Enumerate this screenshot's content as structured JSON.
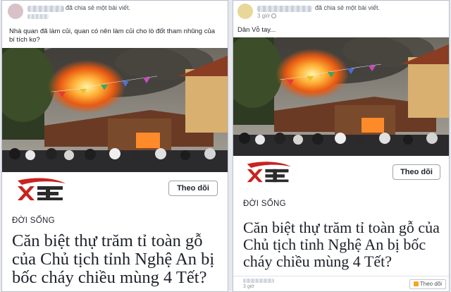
{
  "posts": [
    {
      "shared_text": "đã chia sẻ một bài viết.",
      "time": "",
      "caption": "Nhà quan đã làm củi, quan có nên làm củi cho lò đốt tham nhũng của bí tích ko?",
      "follow_label": "Theo dõi",
      "section": "ĐỜI SỐNG",
      "headline": "Căn biệt thự trăm tỉ toàn gỗ của Chủ tịch tỉnh Nghệ An bị bốc cháy chiều mùng 4 Tết?"
    },
    {
      "shared_text": "đã chia sẻ một bài viết.",
      "time": "3 giờ",
      "caption": "Dân Vỗ tay...",
      "follow_label": "Theo dõi",
      "section": "ĐỜI SỐNG",
      "headline": "Căn biệt thự trăm tỉ toàn gỗ của Chủ tịch tỉnh Nghệ An bị bốc cháy chiều mùng 4 Tết?",
      "footer_time": "3 giờ",
      "footer_button": "Theo dõi"
    }
  ],
  "icons": {
    "logo": "xe-logo",
    "globe": "globe-icon",
    "rss": "rss-icon"
  },
  "colors": {
    "logo_red": "#c8231f",
    "logo_dark": "#2b2b2b",
    "fire": "#ff7a1a"
  }
}
